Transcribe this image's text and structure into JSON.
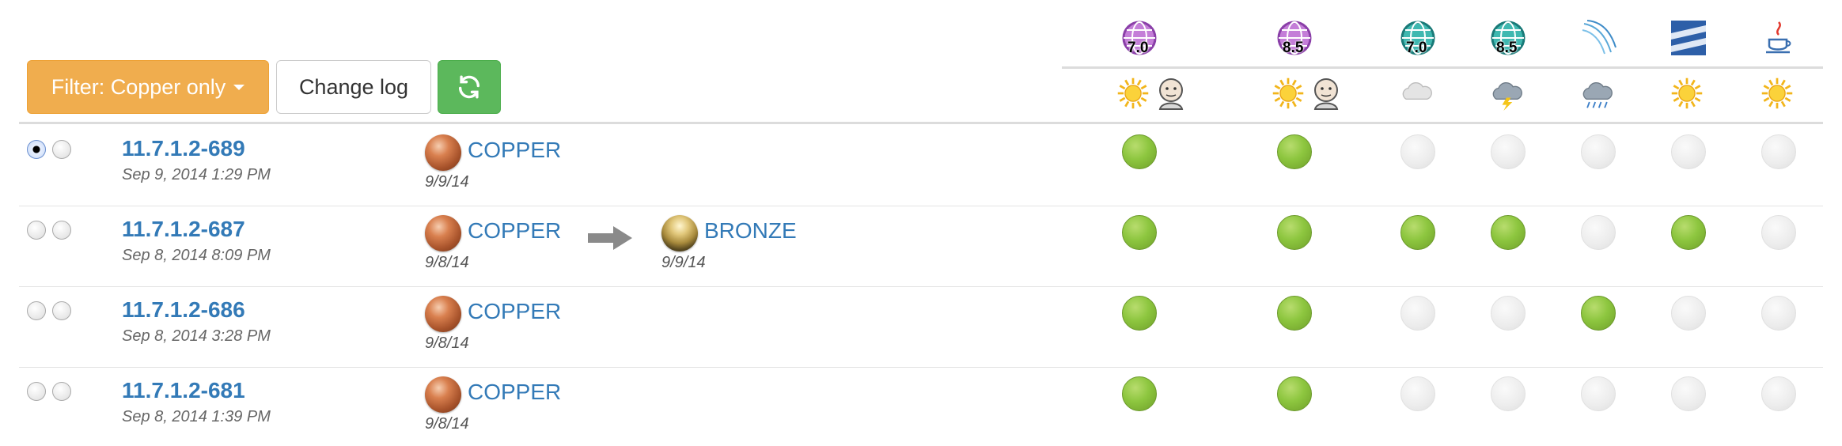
{
  "toolbar": {
    "filter_label": "Filter: Copper only",
    "changelog_label": "Change log",
    "refresh_icon": "refresh-icon"
  },
  "columns": [
    {
      "icon": "purple-globe-icon",
      "version": "7.0",
      "weather_icon": "sun-icon",
      "has_jenkins": true
    },
    {
      "icon": "purple-globe-icon",
      "version": "8.5",
      "weather_icon": "sun-icon",
      "has_jenkins": true
    },
    {
      "icon": "teal-globe-icon",
      "version": "7.0",
      "weather_icon": "cloud-icon",
      "has_jenkins": false
    },
    {
      "icon": "teal-globe-icon",
      "version": "8.5",
      "weather_icon": "storm-icon",
      "has_jenkins": false
    },
    {
      "icon": "wind-lines-icon",
      "version": "",
      "weather_icon": "rain-icon",
      "has_jenkins": false
    },
    {
      "icon": "stripes-icon",
      "version": "",
      "weather_icon": "sun-icon",
      "has_jenkins": false
    },
    {
      "icon": "java-cup-icon",
      "version": "",
      "weather_icon": "sun-icon",
      "has_jenkins": false
    }
  ],
  "rows": [
    {
      "build": "11.7.1.2-689",
      "date": "Sep 9, 2014 1:29 PM",
      "radio_left_selected": true,
      "levels": [
        {
          "name": "COPPER",
          "type": "copper",
          "date": "9/9/14"
        }
      ],
      "results": [
        "pass",
        "pass",
        "none",
        "none",
        "none",
        "none",
        "none"
      ]
    },
    {
      "build": "11.7.1.2-687",
      "date": "Sep 8, 2014 8:09 PM",
      "radio_left_selected": false,
      "levels": [
        {
          "name": "COPPER",
          "type": "copper",
          "date": "9/8/14"
        },
        {
          "name": "BRONZE",
          "type": "bronze",
          "date": "9/9/14"
        }
      ],
      "results": [
        "pass",
        "pass",
        "pass",
        "pass",
        "none",
        "pass",
        "none"
      ]
    },
    {
      "build": "11.7.1.2-686",
      "date": "Sep 8, 2014 3:28 PM",
      "radio_left_selected": false,
      "levels": [
        {
          "name": "COPPER",
          "type": "copper",
          "date": "9/8/14"
        }
      ],
      "results": [
        "pass",
        "pass",
        "none",
        "none",
        "pass",
        "none",
        "none"
      ]
    },
    {
      "build": "11.7.1.2-681",
      "date": "Sep 8, 2014 1:39 PM",
      "radio_left_selected": false,
      "levels": [
        {
          "name": "COPPER",
          "type": "copper",
          "date": "9/8/14"
        }
      ],
      "results": [
        "pass",
        "pass",
        "none",
        "none",
        "none",
        "none",
        "none"
      ]
    }
  ],
  "colors": {
    "link": "#337ab7",
    "pass": "#8dc63f",
    "warning": "#f0ad4e",
    "success": "#5cb85c"
  }
}
